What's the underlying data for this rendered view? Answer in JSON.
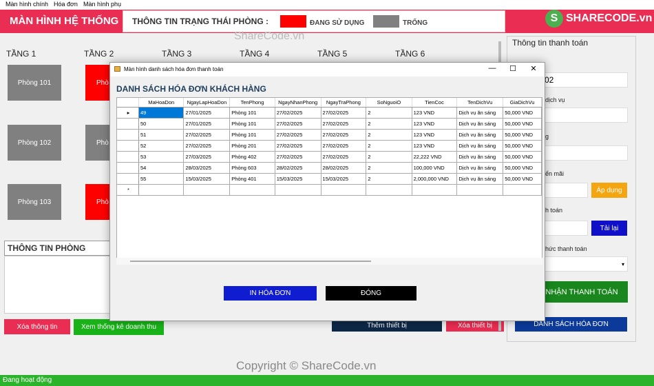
{
  "menu": [
    "Màn hình chính",
    "Hóa đơn",
    "Màn hình phụ"
  ],
  "header": {
    "title": "MÀN HÌNH HỆ THỐNG",
    "status_title": "THÔNG TIN TRẠNG THÁI PHÒNG :",
    "legend_in_use": "ĐANG SỬ DỤNG",
    "legend_empty": "TRỐNG",
    "logo": "SHARECODE.vn",
    "logo_mark": "S"
  },
  "colors": {
    "header": "#ea2d52",
    "in_use": "#ff0000",
    "empty": "#808080",
    "status_bar": "#2bb32b"
  },
  "floors": [
    "TẦNG 1",
    "TẦNG 2",
    "TẦNG 3",
    "TẦNG 4",
    "TẦNG 5",
    "TẦNG 6"
  ],
  "rooms": {
    "r101": "Phòng 101",
    "r102": "Phòng 102",
    "r103": "Phòng 103",
    "r201": "Phò",
    "r202": "Phò",
    "r203": "Phò"
  },
  "room_info": {
    "title": "THÔNG TIN PHÒNG"
  },
  "buttons": {
    "clear_info": "Xóa thông tin",
    "revenue_stats": "Xem thống kê doanh thu",
    "add_device": "Thêm thiết bị",
    "delete_device": "Xóa thiết bị",
    "apply": "Áp dụng",
    "reload": "Tải lại",
    "confirm_payment": "NHẬN THANH TOÁN",
    "invoice_list": "DANH SÁCH HÓA ĐƠN"
  },
  "payment": {
    "title": "Thông tin thanh toán",
    "room_value": "02",
    "service_label": "dịch vụ",
    "label_g": "g",
    "promo_label": "ến mãi",
    "total_label": "h toán",
    "method_label": "hức thanh toán"
  },
  "dialog": {
    "window_title": "Màn hình danh sách hóa đơn thanh toán",
    "heading": "DANH SÁCH HÓA ĐƠN KHÁCH HÀNG",
    "minimize": "—",
    "maximize": "☐",
    "close": "✕",
    "columns": [
      "MaHoaDon",
      "NgayLapHoaDon",
      "TenPhong",
      "NgayNhanPhong",
      "NgayTraPhong",
      "SoNguoiO",
      "TienCoc",
      "TenDichVu",
      "GiaDichVu"
    ],
    "rows": [
      [
        "49",
        "27/01/2025",
        "Phòng 101",
        "27/02/2025",
        "27/02/2025",
        "2",
        "123 VND",
        "Dịch vụ ăn sáng",
        "50,000 VND"
      ],
      [
        "50",
        "27/01/2025",
        "Phòng 101",
        "27/02/2025",
        "27/02/2025",
        "2",
        "123 VND",
        "Dịch vụ ăn sáng",
        "50,000 VND"
      ],
      [
        "51",
        "27/02/2025",
        "Phòng 101",
        "27/02/2025",
        "27/02/2025",
        "2",
        "123 VND",
        "Dịch vụ ăn sáng",
        "50,000 VND"
      ],
      [
        "52",
        "27/02/2025",
        "Phòng 201",
        "27/02/2025",
        "27/02/2025",
        "2",
        "123 VND",
        "Dịch vụ ăn sáng",
        "50,000 VND"
      ],
      [
        "53",
        "27/03/2025",
        "Phòng 402",
        "27/02/2025",
        "27/02/2025",
        "2",
        "22,222 VND",
        "Dịch vụ ăn sáng",
        "50,000 VND"
      ],
      [
        "54",
        "28/03/2025",
        "Phòng 603",
        "28/02/2025",
        "28/02/2025",
        "2",
        "100,000 VND",
        "Dịch vụ ăn sáng",
        "50,000 VND"
      ],
      [
        "55",
        "15/03/2025",
        "Phòng 401",
        "15/03/2025",
        "15/03/2025",
        "2",
        "2,000,000 VND",
        "Dịch vụ ăn sáng",
        "50,000 VND"
      ]
    ],
    "current_row_marker": "▸",
    "new_row_marker": "*",
    "print_button": "IN HÓA ĐƠN",
    "close_button": "ĐÓNG"
  },
  "status_bar": "Đang hoạt động",
  "watermarks": {
    "top": "ShareCode.vn",
    "bottom": "Copyright © ShareCode.vn"
  }
}
